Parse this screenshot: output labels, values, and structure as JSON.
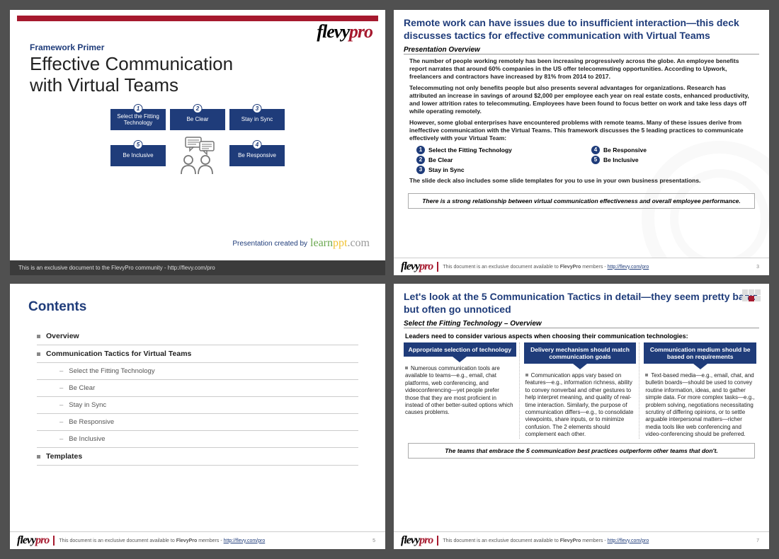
{
  "brand": {
    "part1": "flevy",
    "part2": "pro"
  },
  "slide1": {
    "kicker": "Framework Primer",
    "title_l1": "Effective Communication",
    "title_l2": "with Virtual Teams",
    "boxes": {
      "b1": "Select the Fitting Technology",
      "b2": "Be Clear",
      "b3": "Stay in Sync",
      "b4": "Be Responsive",
      "b5": "Be Inclusive"
    },
    "created_by": "Presentation created by",
    "learn": {
      "a": "learn",
      "b": "ppt",
      "c": ".com"
    },
    "footer": "This is an exclusive document to the FlevyPro community - http://flevy.com/pro"
  },
  "slide2": {
    "headline": "Remote work can have issues due to insufficient interaction—this deck discusses tactics for effective communication with Virtual Teams",
    "subhead": "Presentation Overview",
    "p1": "The number of people working remotely has been increasing progressively across the globe.  An employee benefits report narrates that around 60% companies in the US offer telecommuting opportunities.  According to Upwork, freelancers and contractors have increased by 81% from 2014 to 2017.",
    "p2": "Telecommuting not only benefits people but also presents several advantages for organizations.  Research has attributed an increase in savings of around $2,000 per employee each year on real estate costs, enhanced productivity, and lower attrition rates to telecommuting.  Employees have been found to focus better on work and take less days off while operating remotely.",
    "p3": "However, some global enterprises have encountered problems with remote teams.  Many of these issues derive from ineffective communication with the Virtual Teams.  This framework discusses the 5 leading practices to communicate effectively with your Virtual Team:",
    "li1": "Select the Fitting Technology",
    "li2": "Be Clear",
    "li3": "Stay in Sync",
    "li4": "Be Responsive",
    "li5": "Be Inclusive",
    "p4": "The slide deck also includes some slide templates for you to use in your own business presentations.",
    "callout": "There is a strong relationship between virtual communication effectiveness and overall employee performance.",
    "page": "3"
  },
  "slide3": {
    "title": "Contents",
    "i1": "Overview",
    "i2": "Communication Tactics for Virtual Teams",
    "s1": "Select the Fitting Technology",
    "s2": "Be Clear",
    "s3": "Stay in Sync",
    "s4": "Be Responsive",
    "s5": "Be Inclusive",
    "i3": "Templates",
    "page": "5"
  },
  "slide4": {
    "headline": "Let's look at the 5 Communication Tactics in detail—they seem pretty basic but often go unnoticed",
    "subhead": "Select the Fitting Technology – Overview",
    "lead": "Leaders need to consider various aspects when choosing their communication technologies:",
    "c1_h": "Appropriate selection of technology",
    "c2_h": "Delivery mechanism should match communication goals",
    "c3_h": "Communication medium should be based on requirements",
    "c1_t": "Numerous communication tools are available to teams—e.g., email, chat platforms, web conferencing, and videoconferencing—yet people prefer those that they are most proficient in instead of other better-suited options which causes problems.",
    "c2_t": "Communication apps vary based on features—e.g., information richness, ability to convey nonverbal and other gestures to help interpret meaning, and quality of real-time interaction.  Similarly, the purpose of communication differs—e.g., to consolidate viewpoints, share inputs, or to minimize confusion.  The 2 elements should complement each other.",
    "c3_t": "Text-based media—e.g., email, chat, and bulletin boards—should be used to convey routine information, ideas, and to gather simple data.  For more complex tasks—e.g., problem solving, negotiations necessitating scrutiny of differing opinions, or to settle arguable interpersonal matters—richer media tools like web conferencing and video-conferencing should be preferred.",
    "callout": "The teams that embrace the 5 communication best practices outperform other teams that don't.",
    "page": "7"
  },
  "footer_common": {
    "text_a": "This document is an exclusive document available to ",
    "text_b": "FlevyPro",
    "text_c": " members - ",
    "link": "http://flevy.com/pro"
  }
}
